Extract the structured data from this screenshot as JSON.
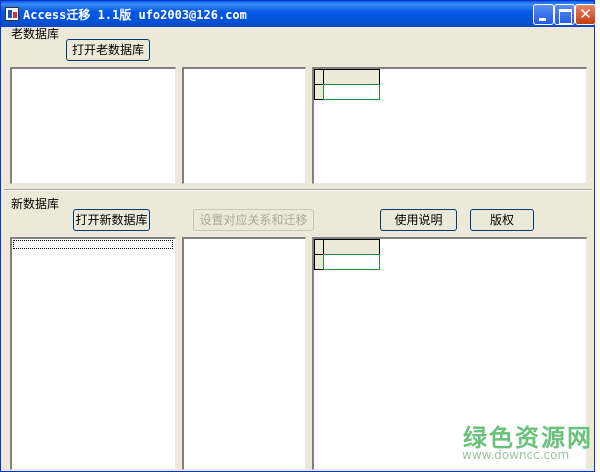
{
  "window": {
    "title": "Access迁移 1.1版 ufo2003@126.com"
  },
  "title_buttons": {
    "close_glyph": "✕"
  },
  "old_section": {
    "label": "老数据库",
    "open_button": "打开老数据库"
  },
  "new_section": {
    "label": "新数据库",
    "open_button": "打开新数据库",
    "mapping_button": "设置对应关系和迁移",
    "help_button": "使用说明",
    "copyright_button": "版权"
  },
  "watermark": {
    "text": "绿色资源网",
    "url": "www.downcc.com"
  },
  "colors": {
    "titlebar": "#0758e6",
    "face": "#ece9d8",
    "grid_border": "#1a8c3c",
    "watermark": "#6ac27a"
  }
}
